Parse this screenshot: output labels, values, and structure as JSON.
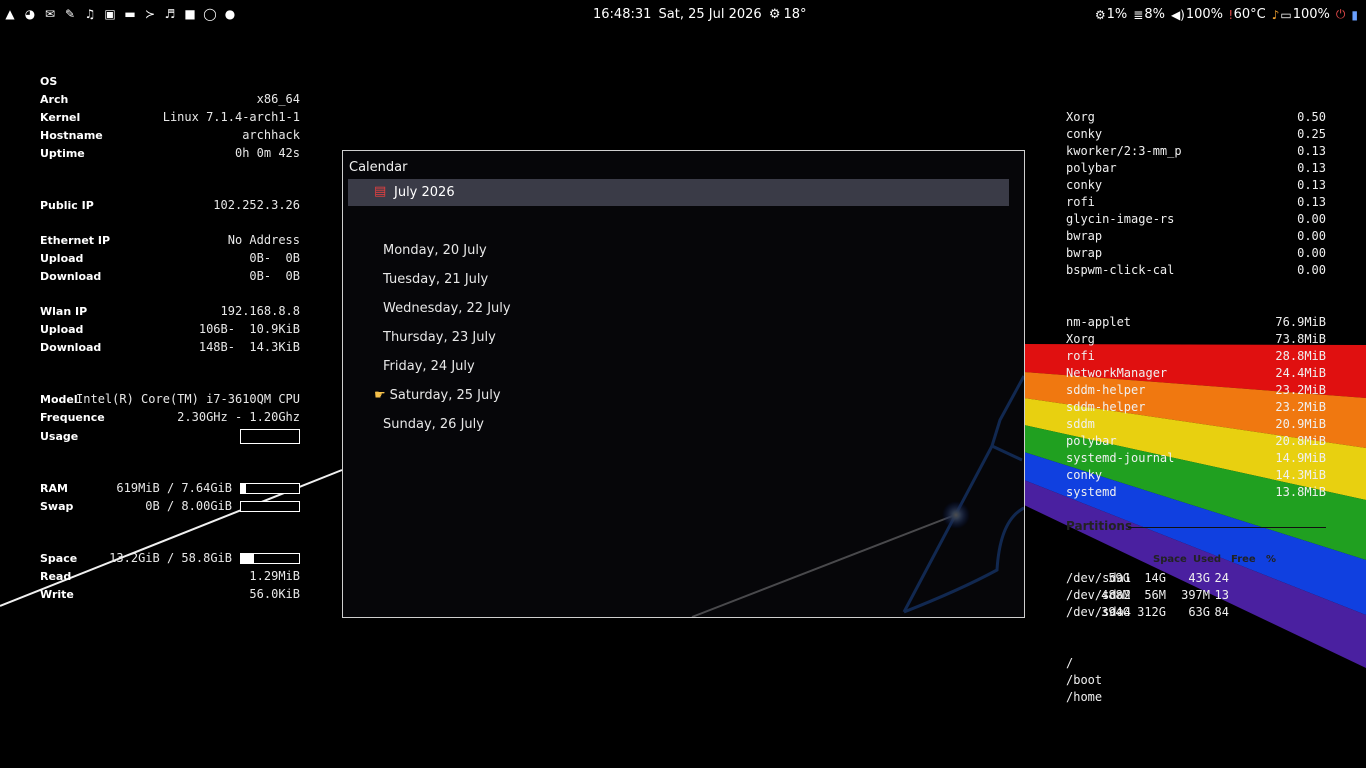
{
  "topbar": {
    "left_icons": [
      "arch-logo-icon",
      "pie-icon",
      "mail-icon",
      "pipette-icon",
      "music-note-icon",
      "image-icon",
      "folder-icon",
      "terminal-icon",
      "music-icon",
      "video-camera-icon",
      "whatsapp-icon",
      "spotify-icon"
    ],
    "clock": "16:48:31",
    "date": "Sat, 25 Jul 2026",
    "weather": "18°",
    "cpu": "1%",
    "memory": "8%",
    "volume": "100%",
    "temperature": "60°C",
    "battery": "100%"
  },
  "conky_left": {
    "os_heading": "OS",
    "system": [
      {
        "label": "Arch",
        "value": "x86_64"
      },
      {
        "label": "Kernel",
        "value": "Linux 7.1.4-arch1-1"
      },
      {
        "label": "Hostname",
        "value": "archhack"
      },
      {
        "label": "Uptime",
        "value": "0h 0m 42s"
      }
    ],
    "public_ip": {
      "label": "Public IP",
      "value": "102.252.3.26"
    },
    "ethernet": [
      {
        "label": "Ethernet IP",
        "value": "No Address"
      },
      {
        "label": "Upload",
        "value": "0B-  0B"
      },
      {
        "label": "Download",
        "value": "0B-  0B"
      }
    ],
    "wlan": [
      {
        "label": "Wlan IP",
        "value": "192.168.8.8"
      },
      {
        "label": "Upload",
        "value": "106B-  10.9KiB"
      },
      {
        "label": "Download",
        "value": "148B-  14.3KiB"
      }
    ],
    "cpu": {
      "model_label": "Model",
      "model_value": "Intel(R) Core(TM) i7-3610QM CPU",
      "freq_label": "Frequence",
      "freq_value": "2.30GHz - 1.20Ghz",
      "usage_label": "Usage"
    },
    "ram": {
      "label": "RAM",
      "value": "619MiB / 7.64GiB",
      "fill": 0.08
    },
    "swap": {
      "label": "Swap",
      "value": "0B / 8.00GiB",
      "fill": 0.0
    },
    "space": {
      "label": "Space",
      "value": "13.2GiB / 58.8GiB",
      "fill": 0.22
    },
    "read": {
      "label": "Read",
      "value": "1.29MiB"
    },
    "write": {
      "label": "Write",
      "value": "56.0KiB"
    }
  },
  "conky_right": {
    "cpu_procs": [
      {
        "name": "Xorg",
        "value": "0.50"
      },
      {
        "name": "conky",
        "value": "0.25"
      },
      {
        "name": "kworker/2:3-mm_p",
        "value": "0.13"
      },
      {
        "name": "polybar",
        "value": "0.13"
      },
      {
        "name": "conky",
        "value": "0.13"
      },
      {
        "name": "rofi",
        "value": "0.13"
      },
      {
        "name": "glycin-image-rs",
        "value": "0.00"
      },
      {
        "name": "bwrap",
        "value": "0.00"
      },
      {
        "name": "bwrap",
        "value": "0.00"
      },
      {
        "name": "bspwm-click-cal",
        "value": "0.00"
      }
    ],
    "mem_procs": [
      {
        "name": "nm-applet",
        "value": "76.9MiB"
      },
      {
        "name": "Xorg",
        "value": "73.8MiB"
      },
      {
        "name": "rofi",
        "value": "28.8MiB"
      },
      {
        "name": "NetworkManager",
        "value": "24.4MiB"
      },
      {
        "name": "sddm-helper",
        "value": "23.2MiB"
      },
      {
        "name": "sddm-helper",
        "value": "23.2MiB"
      },
      {
        "name": "sddm",
        "value": "20.9MiB"
      },
      {
        "name": "polybar",
        "value": "20.8MiB"
      },
      {
        "name": "systemd-journal",
        "value": "14.9MiB"
      },
      {
        "name": "conky",
        "value": "14.3MiB"
      },
      {
        "name": "systemd",
        "value": "13.8MiB"
      }
    ],
    "partitions_title": "Partitions",
    "partition_headers": [
      "Space",
      "Used",
      "Free",
      "%"
    ],
    "partitions": [
      {
        "dev": "/dev/sda1",
        "space": "59G",
        "used": "14G",
        "free": "43G",
        "pct": "24"
      },
      {
        "dev": "/dev/sda2",
        "space": "488M",
        "used": "56M",
        "free": "397M",
        "pct": "13"
      },
      {
        "dev": "/dev/sda4",
        "space": "394G",
        "used": "312G",
        "free": "63G",
        "pct": "84"
      }
    ],
    "mounts": [
      "/",
      "/boot",
      "/home"
    ]
  },
  "calendar": {
    "title": "Calendar",
    "month": "July 2026",
    "days": [
      {
        "label": "Monday, 20 July",
        "today": false
      },
      {
        "label": "Tuesday, 21 July",
        "today": false
      },
      {
        "label": "Wednesday, 22 July",
        "today": false
      },
      {
        "label": "Thursday, 23 July",
        "today": false
      },
      {
        "label": "Friday, 24 July",
        "today": false
      },
      {
        "label": "Saturday, 25 July",
        "today": true
      },
      {
        "label": "Sunday, 26 July",
        "today": false
      }
    ]
  },
  "colors": {
    "background": "#000000",
    "selection": "#3a3b47",
    "rainbow": [
      "#e01010",
      "#f07810",
      "#e8d010",
      "#20a020",
      "#1040e0",
      "#4a20a0"
    ],
    "beam": "#2a7bff"
  }
}
